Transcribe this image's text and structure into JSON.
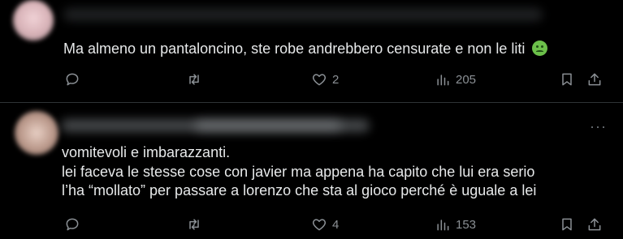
{
  "posts": [
    {
      "text_lines": [
        "Ma almeno un pantaloncino, ste robe andrebbero censurate e non le liti"
      ],
      "emoji": "nauseated-face",
      "reply_count": "",
      "retweet_count": "",
      "like_count": "2",
      "view_count": "205"
    },
    {
      "text_lines": [
        "vomitevoli e imbarazzanti.",
        "lei faceva le stesse cose con javier ma appena ha capito che lui era serio",
        "l’ha “mollato” per passare a lorenzo che sta al gioco perché è uguale a lei"
      ],
      "more_label": "···",
      "reply_count": "",
      "retweet_count": "",
      "like_count": "4",
      "view_count": "153"
    }
  ],
  "colors": {
    "background": "#000000",
    "text": "#e7e9ea",
    "icon": "#71767b",
    "divider": "#2f3336"
  }
}
